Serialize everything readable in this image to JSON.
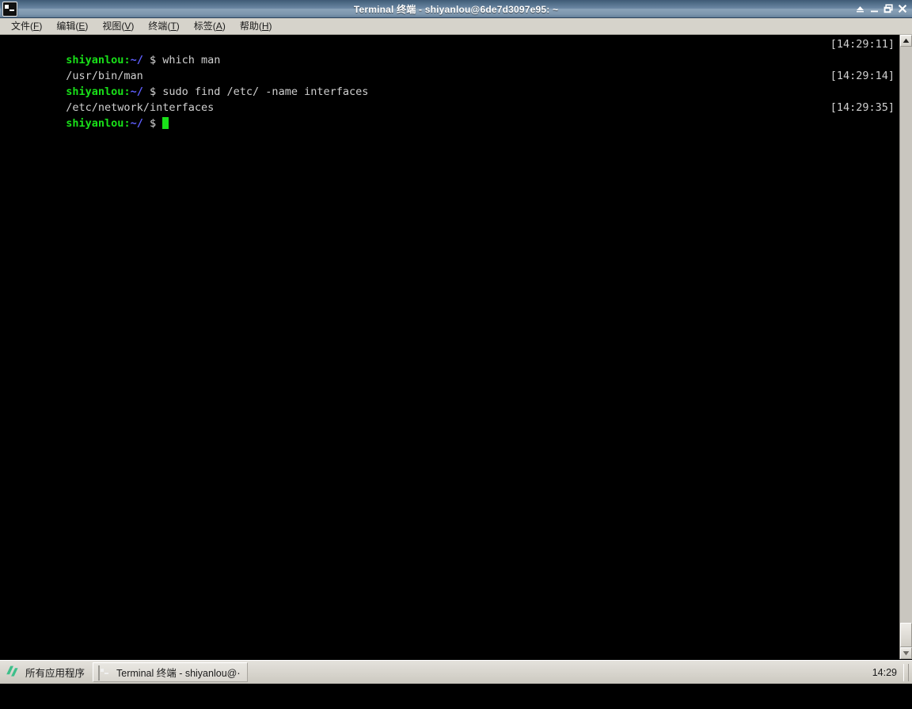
{
  "window": {
    "title": "Terminal 终端 - shiyanlou@6de7d3097e95: ~",
    "icon": "terminal-icon",
    "controls": {
      "shade_label": "▲",
      "minimize_label": "_",
      "maximize_label": "❐",
      "close_label": "✕"
    }
  },
  "menubar": {
    "items": [
      {
        "label": "文件",
        "accel": "F"
      },
      {
        "label": "编辑",
        "accel": "E"
      },
      {
        "label": "视图",
        "accel": "V"
      },
      {
        "label": "终端",
        "accel": "T"
      },
      {
        "label": "标签",
        "accel": "A"
      },
      {
        "label": "帮助",
        "accel": "H"
      }
    ]
  },
  "terminal": {
    "colors": {
      "background": "#000000",
      "user_host": "#19e019",
      "path": "#5f5fff",
      "output": "#d0d0d0",
      "cursor": "#19e019"
    },
    "lines": [
      {
        "type": "prompt",
        "user": "shiyanlou",
        "sep": ":",
        "path": "~/",
        "sigil": "$",
        "command": "which man",
        "timestamp": "[14:29:11]"
      },
      {
        "type": "output",
        "text": "/usr/bin/man"
      },
      {
        "type": "prompt",
        "user": "shiyanlou",
        "sep": ":",
        "path": "~/",
        "sigil": "$",
        "command": "sudo find /etc/ -name interfaces",
        "timestamp": "[14:29:14]"
      },
      {
        "type": "output",
        "text": "/etc/network/interfaces"
      },
      {
        "type": "prompt",
        "user": "shiyanlou",
        "sep": ":",
        "path": "~/",
        "sigil": "$",
        "command": "",
        "timestamp": "[14:29:35]",
        "cursor": true
      }
    ]
  },
  "scrollbar": {
    "up_arrow": "▲",
    "down_arrow": "▼"
  },
  "taskbar": {
    "apps_label": "所有应用程序",
    "logo": "shiyanlou-logo",
    "logo_color": "#3dbf8a",
    "tasks": [
      {
        "label": "Terminal 终端 - shiyanlou@⋯",
        "icon": "terminal-icon",
        "active": true
      }
    ],
    "clock": "14:29"
  }
}
